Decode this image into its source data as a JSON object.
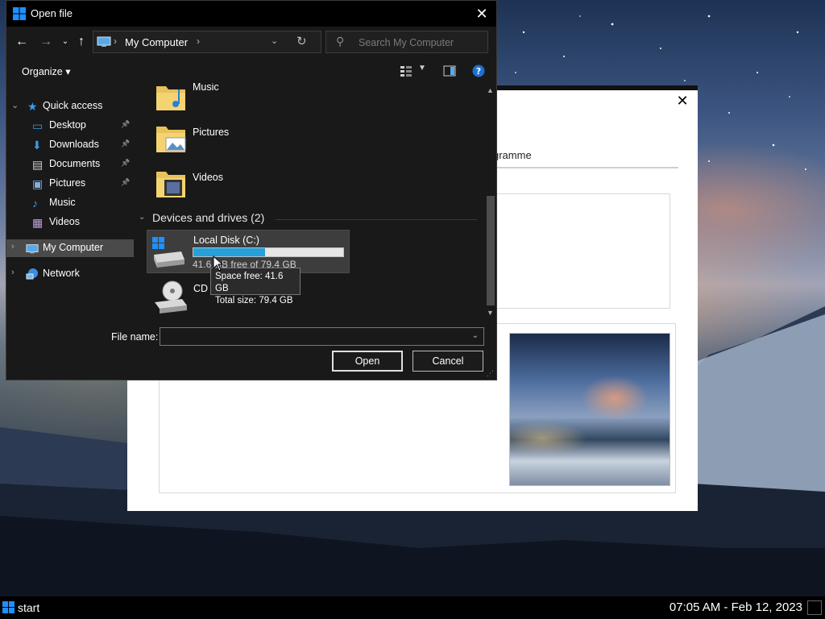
{
  "dialog": {
    "title": "Open file",
    "address": "My Computer",
    "search_placeholder": "Search My Computer",
    "organize_label": "Organize"
  },
  "nav_pane": {
    "quick_access": "Quick access",
    "items": [
      {
        "label": "Desktop",
        "icon": "desktop-icon",
        "pinned": true
      },
      {
        "label": "Downloads",
        "icon": "downloads-icon",
        "pinned": true
      },
      {
        "label": "Documents",
        "icon": "documents-icon",
        "pinned": true
      },
      {
        "label": "Pictures",
        "icon": "pictures-icon",
        "pinned": true
      },
      {
        "label": "Music",
        "icon": "music-icon",
        "pinned": false
      },
      {
        "label": "Videos",
        "icon": "videos-icon",
        "pinned": false
      }
    ],
    "my_computer": "My Computer",
    "network": "Network"
  },
  "content": {
    "folders": [
      {
        "label": "Music",
        "icon": "music-folder-icon"
      },
      {
        "label": "Pictures",
        "icon": "pictures-folder-icon"
      },
      {
        "label": "Videos",
        "icon": "videos-folder-icon"
      }
    ],
    "group_header": "Devices and drives (2)",
    "drive_c": {
      "name": "Local Disk (C:)",
      "free_text": "41.6 GB free of 79.4 GB",
      "used_fraction": 0.476
    },
    "drive_cd": {
      "name": "CD Drive"
    }
  },
  "tooltip": {
    "line1": "Space free: 41.6 GB",
    "line2": "Total size: 79.4 GB"
  },
  "footer": {
    "file_name_label": "File name:",
    "file_name_value": "",
    "open_label": "Open",
    "cancel_label": "Cancel"
  },
  "background_dialog": {
    "tab_label": "gramme"
  },
  "taskbar": {
    "start_label": "start",
    "clock": "07:05 AM - Feb 12, 2023"
  },
  "colors": {
    "accent": "#26a0da",
    "dialog_bg": "#191919",
    "titlebar_bg": "#000000"
  }
}
